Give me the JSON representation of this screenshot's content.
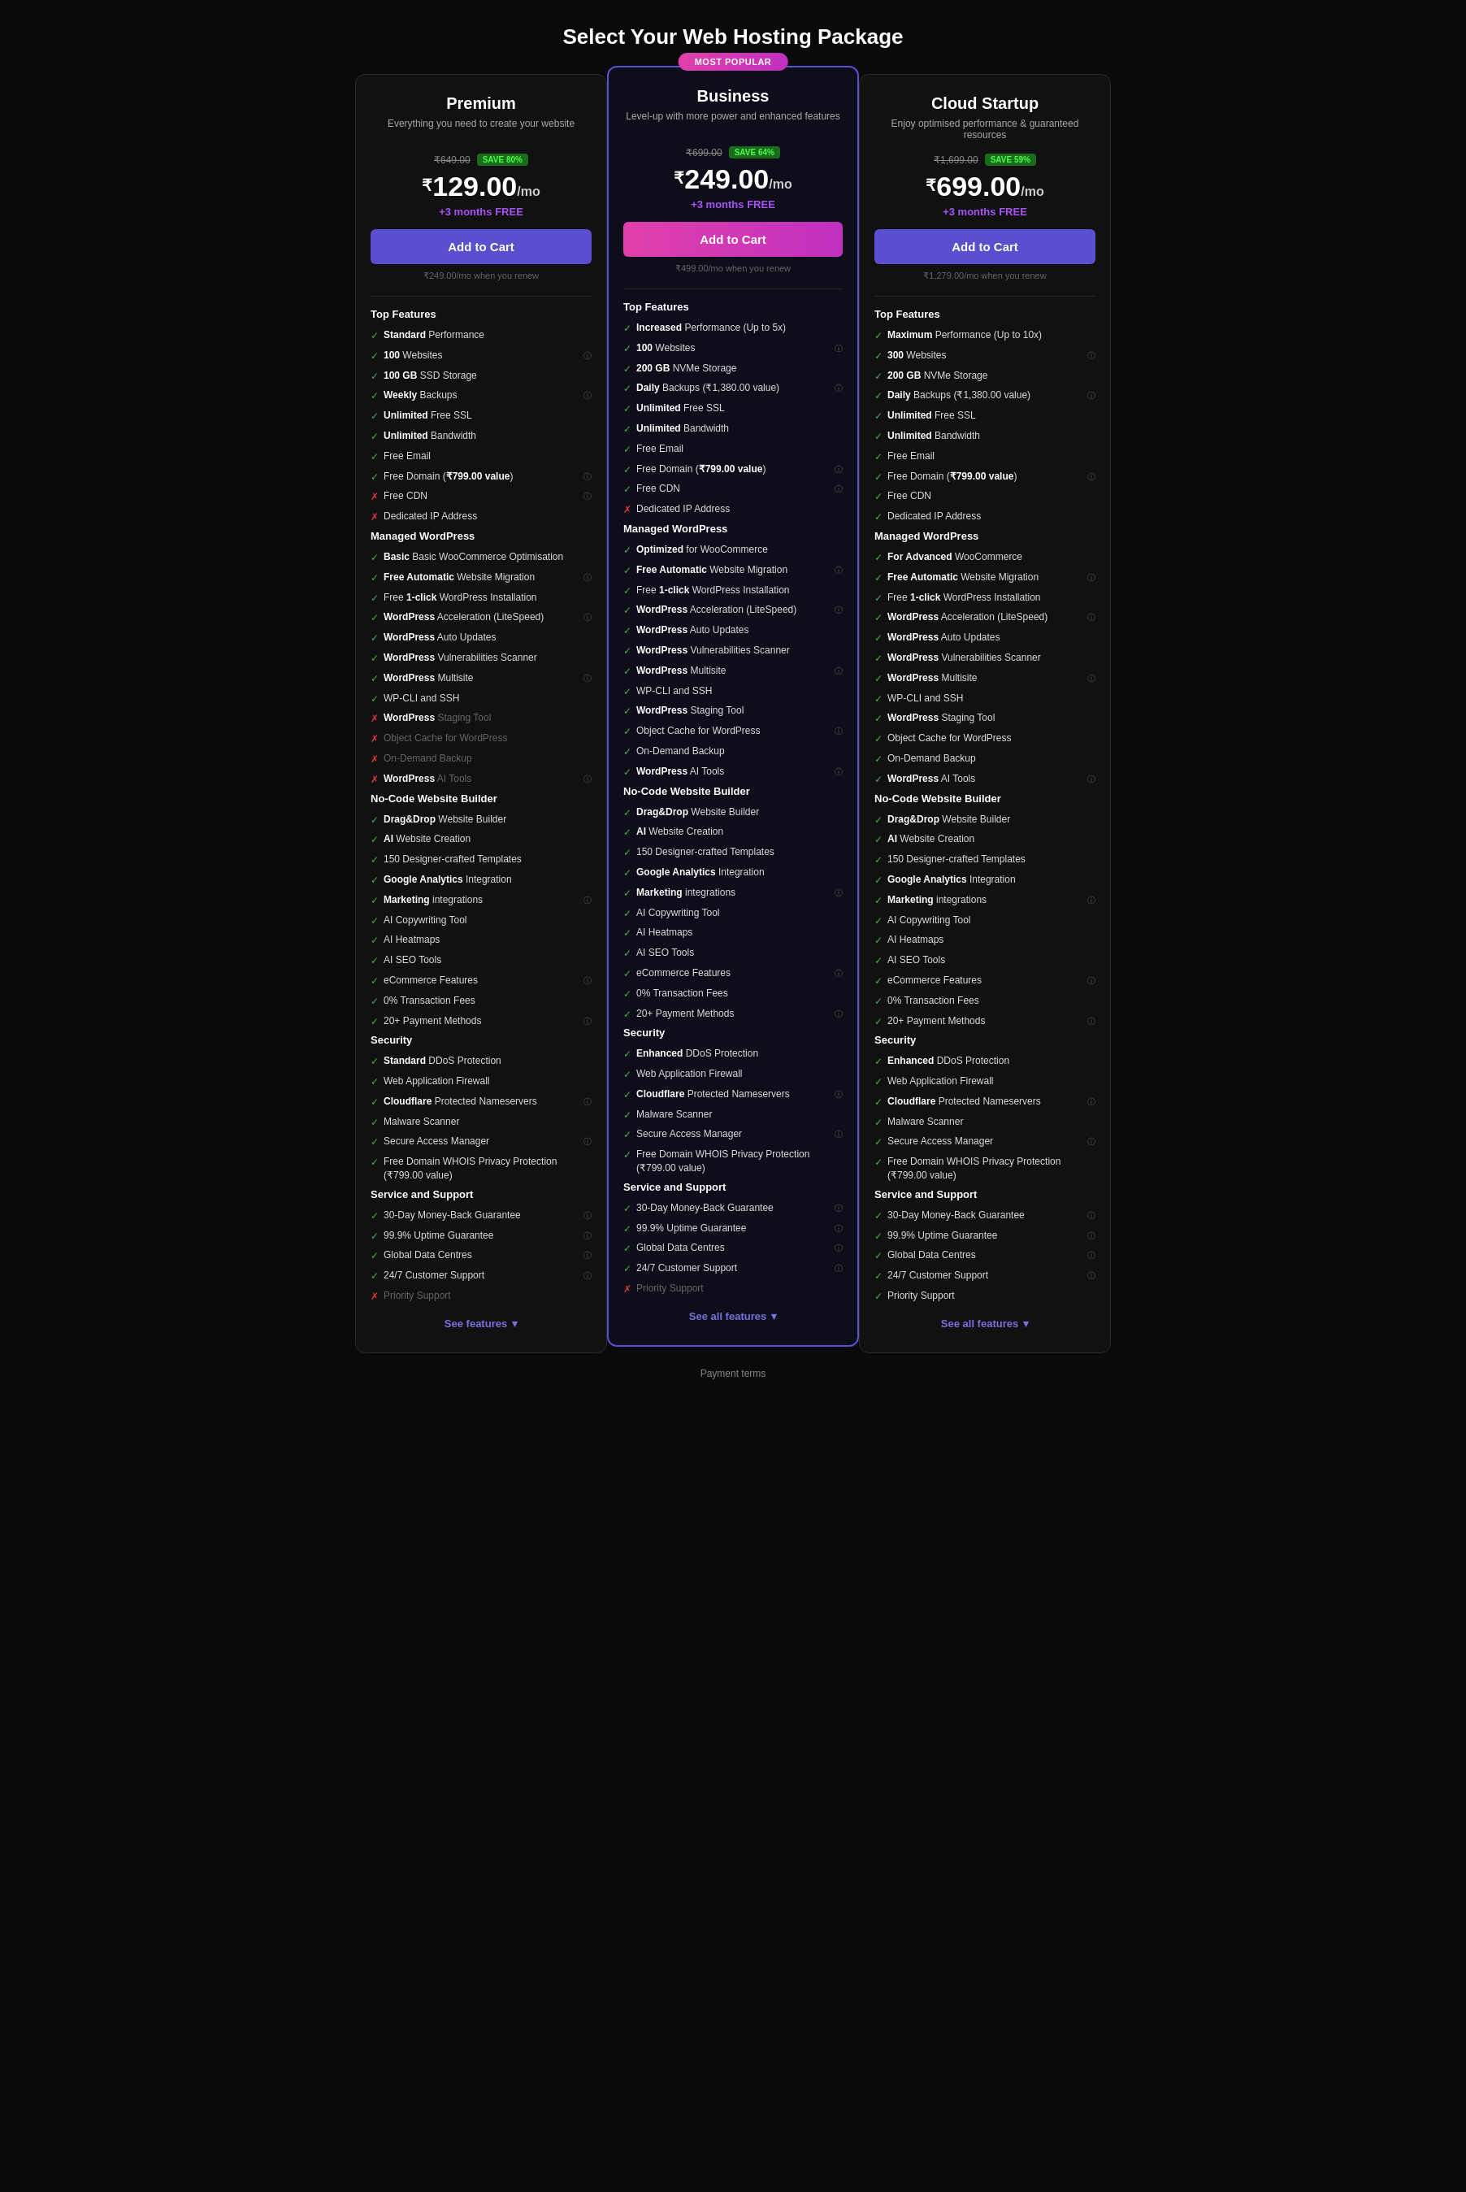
{
  "page": {
    "title": "Select Your Web Hosting Package"
  },
  "plans": [
    {
      "id": "premium",
      "name": "Premium",
      "desc": "Everything you need to create your website",
      "original_price": "₹649.00",
      "save_badge": "SAVE 80%",
      "current_price": "₹129.00",
      "per_mo": "/mo",
      "free_months": "+3 months FREE",
      "add_to_cart": "Add to Cart",
      "renew_note": "₹249.00/mo when you renew",
      "featured": false,
      "btn_class": "btn-purple",
      "sections": [
        {
          "title": "Top Features",
          "features": [
            {
              "icon": "check",
              "text": "<b>Standard</b> Performance"
            },
            {
              "icon": "check",
              "text": "<b>100</b> Websites",
              "info": true
            },
            {
              "icon": "check",
              "text": "<b>100 GB</b> SSD Storage"
            },
            {
              "icon": "check",
              "text": "<b>Weekly</b> Backups",
              "info": true
            },
            {
              "icon": "check",
              "text": "<b>Unlimited</b> Free SSL"
            },
            {
              "icon": "check",
              "text": "<b>Unlimited</b> Bandwidth"
            },
            {
              "icon": "check",
              "text": "Free Email"
            },
            {
              "icon": "check",
              "text": "Free Domain (<b>₹799.00 value</b>)",
              "info": true
            },
            {
              "icon": "cross",
              "text": "Free CDN",
              "info": true
            },
            {
              "icon": "cross",
              "text": "Dedicated IP Address"
            }
          ]
        },
        {
          "title": "Managed WordPress",
          "features": [
            {
              "icon": "check",
              "text": "<b>Basic</b> Basic WooCommerce Optimisation"
            },
            {
              "icon": "check",
              "text": "<b>Free Automatic</b> Website Migration",
              "info": true
            },
            {
              "icon": "check",
              "text": "Free <b>1-click</b> WordPress Installation"
            },
            {
              "icon": "check",
              "text": "<b>WordPress</b> Acceleration (LiteSpeed)",
              "info": true
            },
            {
              "icon": "check",
              "text": "<b>WordPress</b> Auto Updates"
            },
            {
              "icon": "check",
              "text": "<b>WordPress</b> Vulnerabilities Scanner"
            },
            {
              "icon": "check",
              "text": "<b>WordPress</b> Multisite",
              "info": true
            },
            {
              "icon": "check",
              "text": "WP-CLI and SSH"
            },
            {
              "icon": "cross",
              "text": "<b>WordPress</b> Staging Tool",
              "dimmed": true
            },
            {
              "icon": "cross",
              "text": "Object Cache for WordPress",
              "dimmed": true
            },
            {
              "icon": "cross",
              "text": "On-Demand Backup",
              "dimmed": true
            },
            {
              "icon": "cross",
              "text": "<b>WordPress</b> AI Tools",
              "dimmed": true,
              "info": true
            }
          ]
        },
        {
          "title": "No-Code Website Builder",
          "features": [
            {
              "icon": "check",
              "text": "<b>Drag&Drop</b> Website Builder"
            },
            {
              "icon": "check",
              "text": "<b>AI</b> Website Creation"
            },
            {
              "icon": "check",
              "text": "150 Designer-crafted Templates"
            },
            {
              "icon": "check",
              "text": "<b>Google Analytics</b> Integration"
            },
            {
              "icon": "check",
              "text": "<b>Marketing</b> integrations",
              "info": true
            },
            {
              "icon": "check",
              "text": "AI Copywriting Tool"
            },
            {
              "icon": "check",
              "text": "AI Heatmaps"
            },
            {
              "icon": "check",
              "text": "AI SEO Tools"
            },
            {
              "icon": "check",
              "text": "eCommerce Features",
              "info": true
            },
            {
              "icon": "check",
              "text": "0% Transaction Fees"
            },
            {
              "icon": "check",
              "text": "20+ Payment Methods",
              "info": true
            }
          ]
        },
        {
          "title": "Security",
          "features": [
            {
              "icon": "check",
              "text": "<b>Standard</b> DDoS Protection"
            },
            {
              "icon": "check",
              "text": "Web Application Firewall"
            },
            {
              "icon": "check",
              "text": "<b>Cloudflare</b> Protected Nameservers",
              "info": true
            },
            {
              "icon": "check",
              "text": "Malware Scanner"
            },
            {
              "icon": "check",
              "text": "Secure Access Manager",
              "info": true
            },
            {
              "icon": "check",
              "text": "Free Domain WHOIS Privacy Protection (₹799.00 value)"
            }
          ]
        },
        {
          "title": "Service and Support",
          "features": [
            {
              "icon": "check",
              "text": "30-Day Money-Back Guarantee",
              "info": true
            },
            {
              "icon": "check",
              "text": "99.9% Uptime Guarantee",
              "info": true
            },
            {
              "icon": "check",
              "text": "Global Data Centres",
              "info": true
            },
            {
              "icon": "check",
              "text": "24/7 Customer Support",
              "info": true
            },
            {
              "icon": "cross",
              "text": "Priority Support",
              "dimmed": true
            }
          ]
        }
      ],
      "see_all": "See features"
    },
    {
      "id": "business",
      "name": "Business",
      "desc": "Level-up with more power and enhanced features",
      "original_price": "₹699.00",
      "save_badge": "SAVE 64%",
      "current_price": "₹249.00",
      "per_mo": "/mo",
      "free_months": "+3 months FREE",
      "add_to_cart": "Add to Cart",
      "renew_note": "₹499.00/mo when you renew",
      "featured": true,
      "most_popular": "MOST POPULAR",
      "btn_class": "btn-pink",
      "sections": [
        {
          "title": "Top Features",
          "features": [
            {
              "icon": "check",
              "text": "<b>Increased</b> Performance (Up to 5x)"
            },
            {
              "icon": "check",
              "text": "<b>100</b> Websites",
              "info": true
            },
            {
              "icon": "check",
              "text": "<b>200 GB</b> NVMe Storage"
            },
            {
              "icon": "check",
              "text": "<b>Daily</b> Backups (₹1,380.00 value)",
              "info": true
            },
            {
              "icon": "check",
              "text": "<b>Unlimited</b> Free SSL"
            },
            {
              "icon": "check",
              "text": "<b>Unlimited</b> Bandwidth"
            },
            {
              "icon": "check",
              "text": "Free Email"
            },
            {
              "icon": "check",
              "text": "Free Domain (<b>₹799.00 value</b>)",
              "info": true
            },
            {
              "icon": "check",
              "text": "Free CDN",
              "info": true
            },
            {
              "icon": "cross",
              "text": "Dedicated IP Address"
            }
          ]
        },
        {
          "title": "Managed WordPress",
          "features": [
            {
              "icon": "check",
              "text": "<b>Optimized</b> for WooCommerce"
            },
            {
              "icon": "check",
              "text": "<b>Free Automatic</b> Website Migration",
              "info": true
            },
            {
              "icon": "check",
              "text": "Free <b>1-click</b> WordPress Installation"
            },
            {
              "icon": "check",
              "text": "<b>WordPress</b> Acceleration (LiteSpeed)",
              "info": true
            },
            {
              "icon": "check",
              "text": "<b>WordPress</b> Auto Updates"
            },
            {
              "icon": "check",
              "text": "<b>WordPress</b> Vulnerabilities Scanner"
            },
            {
              "icon": "check",
              "text": "<b>WordPress</b> Multisite",
              "info": true
            },
            {
              "icon": "check",
              "text": "WP-CLI and SSH"
            },
            {
              "icon": "check",
              "text": "<b>WordPress</b> Staging Tool"
            },
            {
              "icon": "check",
              "text": "Object Cache for WordPress",
              "info": true
            },
            {
              "icon": "check",
              "text": "On-Demand Backup"
            },
            {
              "icon": "check",
              "text": "<b>WordPress</b> AI Tools",
              "info": true
            }
          ]
        },
        {
          "title": "No-Code Website Builder",
          "features": [
            {
              "icon": "check",
              "text": "<b>Drag&Drop</b> Website Builder"
            },
            {
              "icon": "check",
              "text": "<b>AI</b> Website Creation"
            },
            {
              "icon": "check",
              "text": "150 Designer-crafted Templates"
            },
            {
              "icon": "check",
              "text": "<b>Google Analytics</b> Integration"
            },
            {
              "icon": "check",
              "text": "<b>Marketing</b> integrations",
              "info": true
            },
            {
              "icon": "check",
              "text": "AI Copywriting Tool"
            },
            {
              "icon": "check",
              "text": "AI Heatmaps"
            },
            {
              "icon": "check",
              "text": "AI SEO Tools"
            },
            {
              "icon": "check",
              "text": "eCommerce Features",
              "info": true
            },
            {
              "icon": "check",
              "text": "0% Transaction Fees"
            },
            {
              "icon": "check",
              "text": "20+ Payment Methods",
              "info": true
            }
          ]
        },
        {
          "title": "Security",
          "features": [
            {
              "icon": "check",
              "text": "<b>Enhanced</b> DDoS Protection"
            },
            {
              "icon": "check",
              "text": "Web Application Firewall"
            },
            {
              "icon": "check",
              "text": "<b>Cloudflare</b> Protected Nameservers",
              "info": true
            },
            {
              "icon": "check",
              "text": "Malware Scanner"
            },
            {
              "icon": "check",
              "text": "Secure Access Manager",
              "info": true
            },
            {
              "icon": "check",
              "text": "Free Domain WHOIS Privacy Protection (₹799.00 value)"
            }
          ]
        },
        {
          "title": "Service and Support",
          "features": [
            {
              "icon": "check",
              "text": "30-Day Money-Back Guarantee",
              "info": true
            },
            {
              "icon": "check",
              "text": "99.9% Uptime Guarantee",
              "info": true
            },
            {
              "icon": "check",
              "text": "Global Data Centres",
              "info": true
            },
            {
              "icon": "check",
              "text": "24/7 Customer Support",
              "info": true
            },
            {
              "icon": "cross",
              "text": "Priority Support",
              "dimmed": true
            }
          ]
        }
      ],
      "see_all": "See all features"
    },
    {
      "id": "cloud-startup",
      "name": "Cloud Startup",
      "desc": "Enjoy optimised performance & guaranteed resources",
      "original_price": "₹1,699.00",
      "save_badge": "SAVE 59%",
      "current_price": "₹699.00",
      "per_mo": "/mo",
      "free_months": "+3 months FREE",
      "add_to_cart": "Add to Cart",
      "renew_note": "₹1,279.00/mo when you renew",
      "featured": false,
      "btn_class": "btn-purple",
      "sections": [
        {
          "title": "Top Features",
          "features": [
            {
              "icon": "check",
              "text": "<b>Maximum</b> Performance (Up to 10x)"
            },
            {
              "icon": "check",
              "text": "<b>300</b> Websites",
              "info": true
            },
            {
              "icon": "check",
              "text": "<b>200 GB</b> NVMe Storage"
            },
            {
              "icon": "check",
              "text": "<b>Daily</b> Backups (₹1,380.00 value)",
              "info": true
            },
            {
              "icon": "check",
              "text": "<b>Unlimited</b> Free SSL"
            },
            {
              "icon": "check",
              "text": "<b>Unlimited</b> Bandwidth"
            },
            {
              "icon": "check",
              "text": "Free Email"
            },
            {
              "icon": "check",
              "text": "Free Domain (<b>₹799.00 value</b>)",
              "info": true
            },
            {
              "icon": "check",
              "text": "Free CDN"
            },
            {
              "icon": "check",
              "text": "Dedicated IP Address"
            }
          ]
        },
        {
          "title": "Managed WordPress",
          "features": [
            {
              "icon": "check",
              "text": "<b>For Advanced</b> WooCommerce"
            },
            {
              "icon": "check",
              "text": "<b>Free Automatic</b> Website Migration",
              "info": true
            },
            {
              "icon": "check",
              "text": "Free <b>1-click</b> WordPress Installation"
            },
            {
              "icon": "check",
              "text": "<b>WordPress</b> Acceleration (LiteSpeed)",
              "info": true
            },
            {
              "icon": "check",
              "text": "<b>WordPress</b> Auto Updates"
            },
            {
              "icon": "check",
              "text": "<b>WordPress</b> Vulnerabilities Scanner"
            },
            {
              "icon": "check",
              "text": "<b>WordPress</b> Multisite",
              "info": true
            },
            {
              "icon": "check",
              "text": "WP-CLI and SSH"
            },
            {
              "icon": "check",
              "text": "<b>WordPress</b> Staging Tool"
            },
            {
              "icon": "check",
              "text": "Object Cache for WordPress"
            },
            {
              "icon": "check",
              "text": "On-Demand Backup"
            },
            {
              "icon": "check",
              "text": "<b>WordPress</b> AI Tools",
              "info": true
            }
          ]
        },
        {
          "title": "No-Code Website Builder",
          "features": [
            {
              "icon": "check",
              "text": "<b>Drag&Drop</b> Website Builder"
            },
            {
              "icon": "check",
              "text": "<b>AI</b> Website Creation"
            },
            {
              "icon": "check",
              "text": "150 Designer-crafted Templates"
            },
            {
              "icon": "check",
              "text": "<b>Google Analytics</b> Integration"
            },
            {
              "icon": "check",
              "text": "<b>Marketing</b> integrations",
              "info": true
            },
            {
              "icon": "check",
              "text": "AI Copywriting Tool"
            },
            {
              "icon": "check",
              "text": "AI Heatmaps"
            },
            {
              "icon": "check",
              "text": "AI SEO Tools"
            },
            {
              "icon": "check",
              "text": "eCommerce Features",
              "info": true
            },
            {
              "icon": "check",
              "text": "0% Transaction Fees"
            },
            {
              "icon": "check",
              "text": "20+ Payment Methods",
              "info": true
            }
          ]
        },
        {
          "title": "Security",
          "features": [
            {
              "icon": "check",
              "text": "<b>Enhanced</b> DDoS Protection"
            },
            {
              "icon": "check",
              "text": "Web Application Firewall"
            },
            {
              "icon": "check",
              "text": "<b>Cloudflare</b> Protected Nameservers",
              "info": true
            },
            {
              "icon": "check",
              "text": "Malware Scanner"
            },
            {
              "icon": "check",
              "text": "Secure Access Manager",
              "info": true
            },
            {
              "icon": "check",
              "text": "Free Domain WHOIS Privacy Protection (₹799.00 value)"
            }
          ]
        },
        {
          "title": "Service and Support",
          "features": [
            {
              "icon": "check",
              "text": "30-Day Money-Back Guarantee",
              "info": true
            },
            {
              "icon": "check",
              "text": "99.9% Uptime Guarantee",
              "info": true
            },
            {
              "icon": "check",
              "text": "Global Data Centres",
              "info": true
            },
            {
              "icon": "check",
              "text": "24/7 Customer Support",
              "info": true
            },
            {
              "icon": "check",
              "text": "Priority Support"
            }
          ]
        }
      ],
      "see_all": "See all features"
    }
  ],
  "footer": {
    "payment_terms": "Payment terms"
  }
}
